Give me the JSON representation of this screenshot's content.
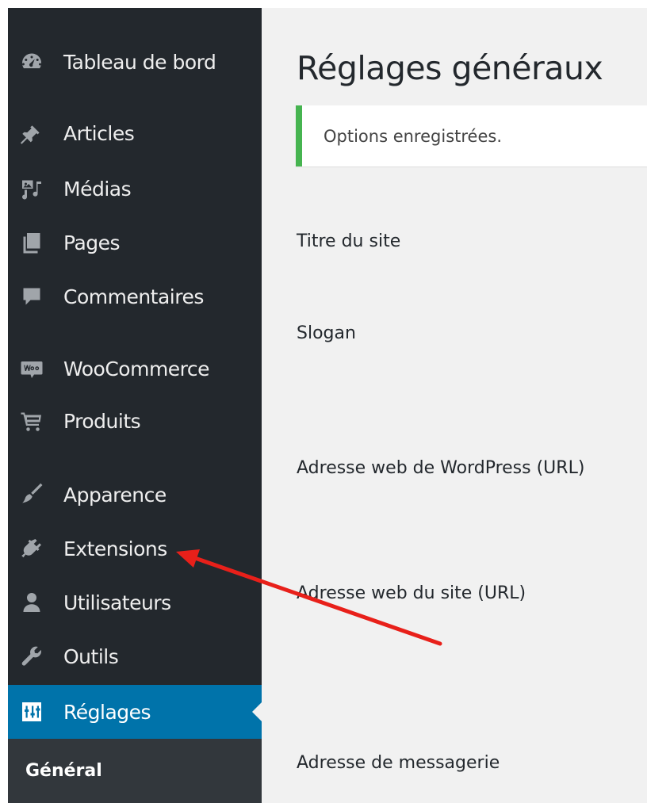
{
  "sidebar": {
    "items": [
      {
        "label": "Tableau de bord",
        "icon": "dashboard-icon"
      },
      {
        "label": "Articles",
        "icon": "pin-icon"
      },
      {
        "label": "Médias",
        "icon": "media-icon"
      },
      {
        "label": "Pages",
        "icon": "pages-icon"
      },
      {
        "label": "Commentaires",
        "icon": "comment-icon"
      },
      {
        "label": "WooCommerce",
        "icon": "woocommerce-icon"
      },
      {
        "label": "Produits",
        "icon": "cart-icon"
      },
      {
        "label": "Apparence",
        "icon": "paintbrush-icon"
      },
      {
        "label": "Extensions",
        "icon": "plugin-icon"
      },
      {
        "label": "Utilisateurs",
        "icon": "user-icon"
      },
      {
        "label": "Outils",
        "icon": "wrench-icon"
      },
      {
        "label": "Réglages",
        "icon": "settings-sliders-icon"
      }
    ],
    "active_item": "Réglages",
    "submenu": {
      "current": "Général"
    }
  },
  "main": {
    "title": "Réglages généraux",
    "notice": "Options enregistrées.",
    "fields": [
      {
        "label": "Titre du site"
      },
      {
        "label": "Slogan"
      },
      {
        "label": "Adresse web de WordPress (URL)"
      },
      {
        "label": "Adresse web du site (URL)"
      },
      {
        "label": "Adresse de messagerie"
      }
    ]
  },
  "colors": {
    "sidebar_bg": "#23282d",
    "active_bg": "#0073aa",
    "submenu_bg": "#32373c",
    "content_bg": "#f1f1f1",
    "notice_border": "#46b450",
    "annotation_arrow": "#e8201a"
  }
}
